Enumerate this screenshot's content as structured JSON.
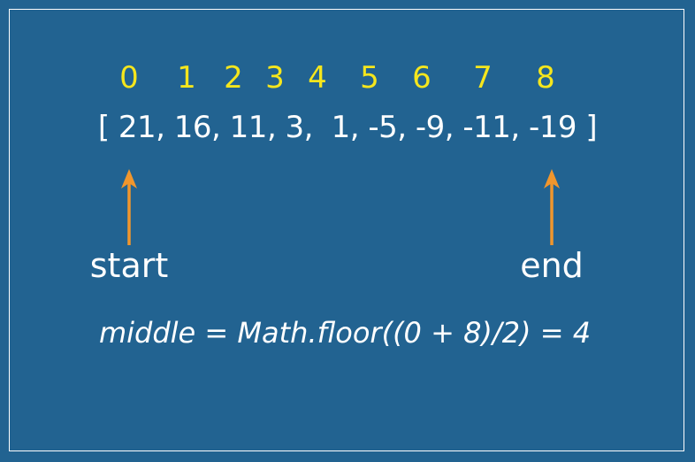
{
  "indices": [
    "0",
    "1",
    "2",
    "3",
    "4",
    "5",
    "6",
    "7",
    "8"
  ],
  "array_text": "[ 21, 16, 11, 3,  1, -5, -9, -11, -19 ]",
  "labels": {
    "start": "start",
    "end": "end"
  },
  "formula": "middle = Math.floor((0 + 8)/2) = 4",
  "colors": {
    "background": "#226391",
    "index_text": "#f5e61d",
    "arrow": "#f0962d",
    "text": "#ffffff"
  }
}
